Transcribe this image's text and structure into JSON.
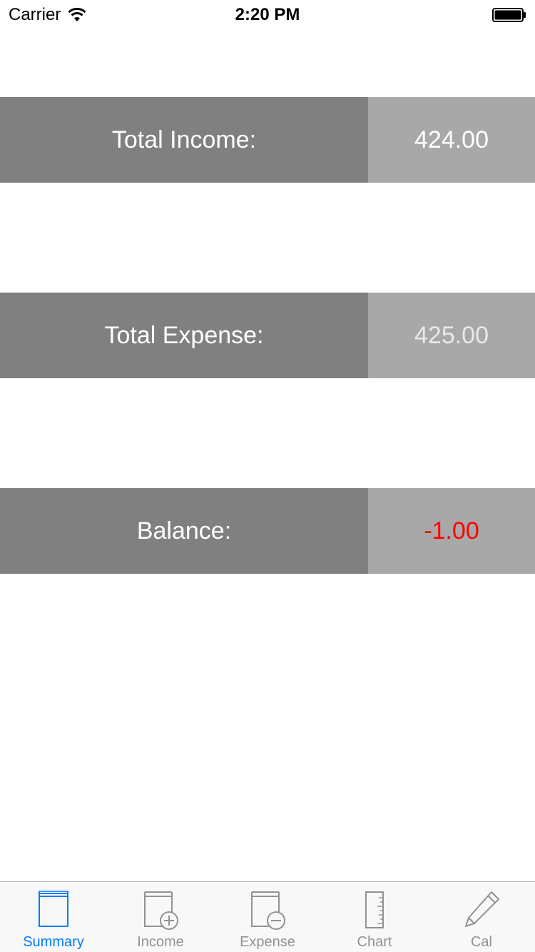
{
  "status_bar": {
    "carrier": "Carrier",
    "time": "2:20 PM"
  },
  "summary": {
    "income_label": "Total Income:",
    "income_value": "424.00",
    "expense_label": "Total Expense:",
    "expense_value": "425.00",
    "balance_label": "Balance:",
    "balance_value": "-1.00"
  },
  "tabs": [
    {
      "label": "Summary",
      "icon": "book-icon",
      "active": true
    },
    {
      "label": "Income",
      "icon": "book-plus-icon",
      "active": false
    },
    {
      "label": "Expense",
      "icon": "book-minus-icon",
      "active": false
    },
    {
      "label": "Chart",
      "icon": "ruler-icon",
      "active": false
    },
    {
      "label": "Cal",
      "icon": "pencil-icon",
      "active": false
    }
  ],
  "colors": {
    "label_bg": "#808080",
    "value_bg": "#a8a8a8",
    "negative": "#ff0000",
    "tab_active": "#007aff",
    "tab_inactive": "#929292"
  }
}
